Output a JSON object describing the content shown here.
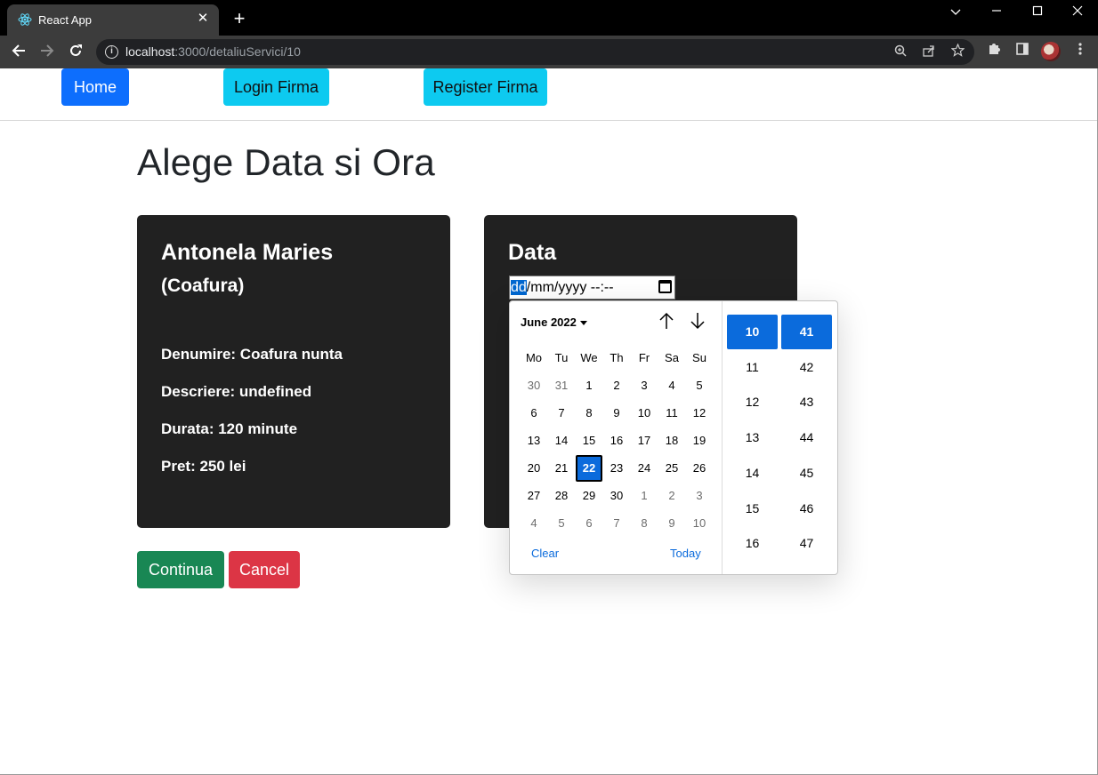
{
  "browser": {
    "tab_title": "React App",
    "tab_close": "✕",
    "new_tab": "+",
    "url_host": "localhost",
    "url_rest": ":3000/detaliuServici/10"
  },
  "nav": {
    "home": "Home",
    "login": "Login Firma",
    "register": "Register Firma"
  },
  "page_title": "Alege Data si Ora",
  "service_card": {
    "name": "Antonela Maries",
    "category": "(Coafura)",
    "denumire": "Denumire: Coafura nunta",
    "descriere": "Descriere: undefined",
    "durata": "Durata: 120 minute",
    "pret": "Pret: 250 lei"
  },
  "date_card": {
    "title": "Data",
    "input_segment": "dd",
    "input_rest": "/mm/yyyy --:--"
  },
  "picker": {
    "month_label": "June 2022",
    "weekdays": [
      "Mo",
      "Tu",
      "We",
      "Th",
      "Fr",
      "Sa",
      "Su"
    ],
    "weeks": [
      [
        "30",
        "31",
        "1",
        "2",
        "3",
        "4",
        "5"
      ],
      [
        "6",
        "7",
        "8",
        "9",
        "10",
        "11",
        "12"
      ],
      [
        "13",
        "14",
        "15",
        "16",
        "17",
        "18",
        "19"
      ],
      [
        "20",
        "21",
        "22",
        "23",
        "24",
        "25",
        "26"
      ],
      [
        "27",
        "28",
        "29",
        "30",
        "1",
        "2",
        "3"
      ],
      [
        "4",
        "5",
        "6",
        "7",
        "8",
        "9",
        "10"
      ]
    ],
    "selected_day": "22",
    "clear_label": "Clear",
    "today_label": "Today",
    "hours": [
      "10",
      "11",
      "12",
      "13",
      "14",
      "15",
      "16"
    ],
    "minutes": [
      "41",
      "42",
      "43",
      "44",
      "45",
      "46",
      "47"
    ],
    "selected_hour": "10",
    "selected_minute": "41"
  },
  "actions": {
    "continua": "Continua",
    "cancel": "Cancel"
  }
}
